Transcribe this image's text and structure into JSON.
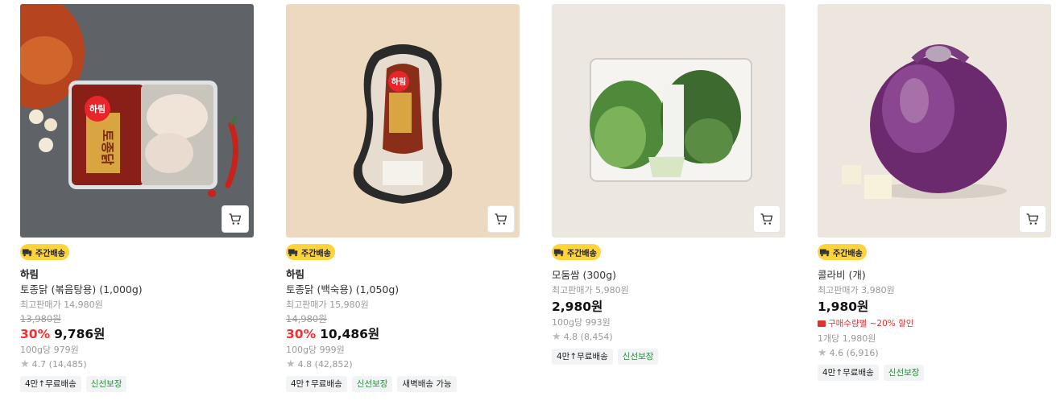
{
  "products": [
    {
      "badge": "주간배송",
      "brand": "하림",
      "name": "토종닭 (볶음탕용) (1,000g)",
      "max_price": "최고판매가 14,980원",
      "original_price": "13,980원",
      "discount": "30%",
      "price": "9,786원",
      "unit_price": "100g당 979원",
      "rating": "4.7 (14,485)",
      "tags": [
        "4만↑무료배송",
        "신선보장"
      ]
    },
    {
      "badge": "주간배송",
      "brand": "하림",
      "name": "토종닭 (백숙용) (1,050g)",
      "max_price": "최고판매가 15,980원",
      "original_price": "14,980원",
      "discount": "30%",
      "price": "10,486원",
      "unit_price": "100g당 999원",
      "rating": "4.8 (42,852)",
      "tags": [
        "4만↑무료배송",
        "신선보장",
        "새벽배송 가능"
      ]
    },
    {
      "badge": "주간배송",
      "name": "모둠쌈 (300g)",
      "max_price": "최고판매가 5,980원",
      "price": "2,980원",
      "unit_price": "100g당 993원",
      "rating": "4.8 (8,454)",
      "tags": [
        "4만↑무료배송",
        "신선보장"
      ]
    },
    {
      "badge": "주간배송",
      "name": "콜라비 (개)",
      "max_price": "최고판매가 3,980원",
      "price": "1,980원",
      "coupon": "구매수량별 ~20% 할인",
      "unit_price": "1개당 1,980원",
      "rating": "4.6 (6,916)",
      "tags": [
        "4만↑무료배송",
        "신선보장"
      ]
    }
  ],
  "image_text": {
    "harim_logo": "하림",
    "tojongdak": "토종닭"
  },
  "colors": {
    "discount": "#fa2d2d",
    "badge_bg": "#ffd43b",
    "fresh_tag": "#2b8a3e",
    "coupon": "#e03131"
  },
  "icons": {
    "cart": "cart-icon",
    "truck": "truck-icon",
    "star": "star-icon",
    "coupon": "coupon-icon"
  }
}
